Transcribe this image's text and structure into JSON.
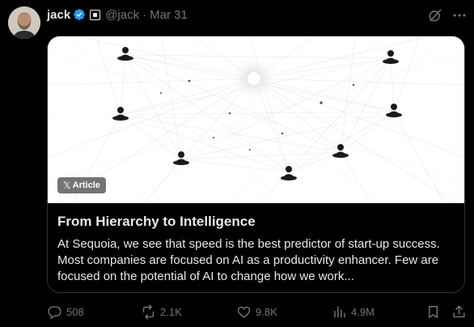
{
  "author": {
    "name": "jack",
    "handle": "@jack",
    "separator": "·",
    "date": "Mar 31"
  },
  "card": {
    "badge_x": "𝕏",
    "badge_label": "Article",
    "title": "From Hierarchy to Intelligence",
    "description": "At Sequoia, we see that speed is the best predictor of start-up success. Most companies are focused on AI as a productivity enhancer. Few are focused on the potential of AI to change how we work..."
  },
  "actions": {
    "replies": "508",
    "reposts": "2.1K",
    "likes": "9.8K",
    "views": "4.9M"
  },
  "colors": {
    "background": "#000000",
    "text": "#e7e9ea",
    "muted": "#71767b",
    "verified": "#1d9bf0",
    "border": "#2f3336"
  }
}
